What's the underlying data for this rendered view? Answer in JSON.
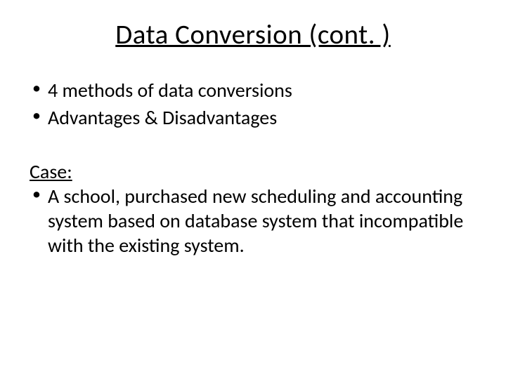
{
  "title": "Data Conversion (cont. )",
  "bullets": {
    "item0": "4 methods of data conversions",
    "item1": "Advantages & Disadvantages"
  },
  "case": {
    "label": "Case:",
    "item0": "A school, purchased new scheduling and accounting system based on database system that incompatible with the existing system."
  }
}
